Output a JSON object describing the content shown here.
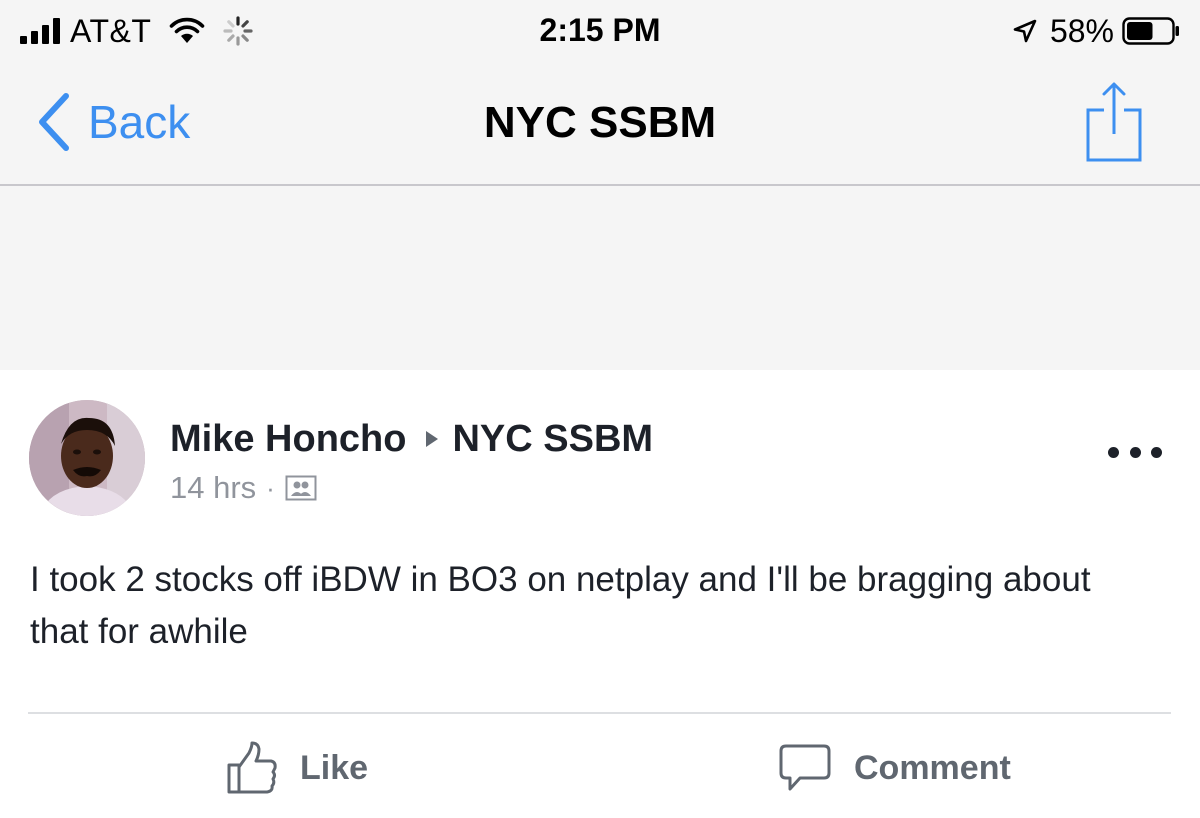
{
  "status_bar": {
    "carrier": "AT&T",
    "time": "2:15 PM",
    "battery_percent": "58%",
    "battery_level": 0.58,
    "icons": [
      "signal-icon",
      "wifi-icon",
      "activity-spinner-icon",
      "location-arrow-icon",
      "battery-icon"
    ]
  },
  "nav": {
    "back_label": "Back",
    "title": "NYC SSBM",
    "share_icon": "share-icon",
    "accent_color": "#3d8ff0"
  },
  "post": {
    "author": "Mike Honcho",
    "group": "NYC SSBM",
    "time": "14 hrs",
    "separator": "·",
    "privacy_icon": "group-members-icon",
    "text": "I took 2 stocks off iBDW in BO3 on netplay and I'll be bragging about that for awhile",
    "more_icon": "more-options-icon",
    "actions": {
      "like_label": "Like",
      "comment_label": "Comment"
    }
  }
}
